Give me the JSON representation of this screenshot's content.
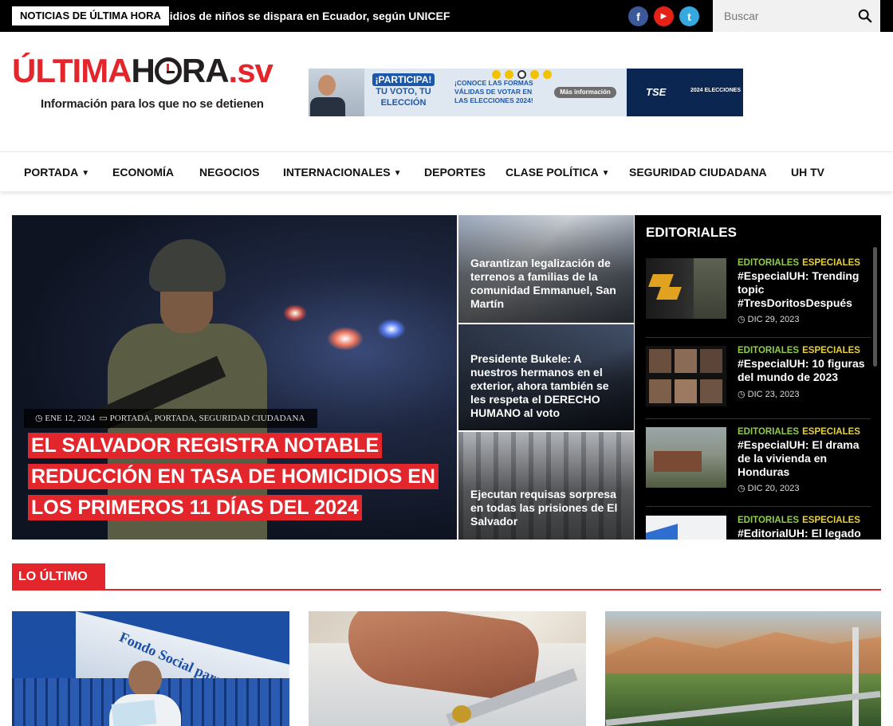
{
  "topbar": {
    "breaking_label": "NOTICIAS DE ÚLTIMA HORA",
    "ticker_text": "cidios de niños se dispara en Ecuador, según UNICEF",
    "social": {
      "facebook": "f",
      "youtube": "▶",
      "twitter": "t"
    },
    "search_placeholder": "Buscar"
  },
  "header": {
    "logo_part1": "ÚLTIMA",
    "logo_part2": "H",
    "logo_part3": "RA",
    "logo_part4": ".sv",
    "tagline": "Información para los que no se detienen",
    "banner": {
      "participa": "¡PARTICIPA!",
      "voto": "TU VOTO, TU ELECCIÓN",
      "text": "¡CONOCE LAS FORMAS VÁLIDAS DE VOTAR EN LAS ELECCIONES 2024!",
      "button": "Más información",
      "tse": "TSE",
      "year": "2024 ELECCIONES"
    }
  },
  "nav": [
    {
      "label": "PORTADA",
      "dropdown": true
    },
    {
      "label": "ECONOMÍA",
      "dropdown": false
    },
    {
      "label": "NEGOCIOS",
      "dropdown": false
    },
    {
      "label": "INTERNACIONALES",
      "dropdown": true
    },
    {
      "label": "DEPORTES",
      "dropdown": false
    },
    {
      "label": "CLASE POLÍTICA",
      "dropdown": true
    },
    {
      "label": "SEGURIDAD CIUDADANA",
      "dropdown": false
    },
    {
      "label": "UH TV",
      "dropdown": false
    }
  ],
  "hero": {
    "date": "ENE 12, 2024",
    "categories": "PORTADA, PORTADA, SEGURIDAD CIUDADANA",
    "title_lines": [
      "EL SALVADOR REGISTRA NOTABLE",
      "REDUCCIÓN EN TASA DE HOMICIDIOS EN",
      "LOS PRIMEROS 11 DÍAS DEL 2024"
    ]
  },
  "side_stories": [
    {
      "title": "Garantizan legalización de terrenos a familias de la comunidad Emmanuel, San Martín"
    },
    {
      "title": "Presidente Bukele: A nuestros hermanos en el exterior, ahora también se les respeta el DERECHO HUMANO al voto"
    },
    {
      "title": "Ejecutan requisas sorpresa en todas las prisiones de El Salvador"
    }
  ],
  "editorials": {
    "title": "EDITORIALES",
    "items": [
      {
        "cat1": "EDITORIALES",
        "cat2": "ESPECIALES",
        "title": "#EspecialUH: Trending topic #TresDoritosDespués",
        "date": "DIC 29, 2023"
      },
      {
        "cat1": "EDITORIALES",
        "cat2": "ESPECIALES",
        "title": "#EspecialUH: 10 figuras del mundo de 2023",
        "date": "DIC 23, 2023"
      },
      {
        "cat1": "EDITORIALES",
        "cat2": "ESPECIALES",
        "title": "#EspecialUH: El drama de la vivienda en Honduras",
        "date": "DIC 20, 2023"
      },
      {
        "cat1": "EDITORIALES",
        "cat2": "ESPECIALES",
        "title": "#EditorialUH: El legado",
        "date": ""
      }
    ]
  },
  "latest": {
    "label": "LO ÚLTIMO",
    "sign_text": "Fondo Social para la Vivienda"
  },
  "colors": {
    "brand_red": "#e3262c",
    "dark": "#231f20",
    "cat_green": "#8fce4a",
    "cat_yellow": "#e8d23a"
  }
}
